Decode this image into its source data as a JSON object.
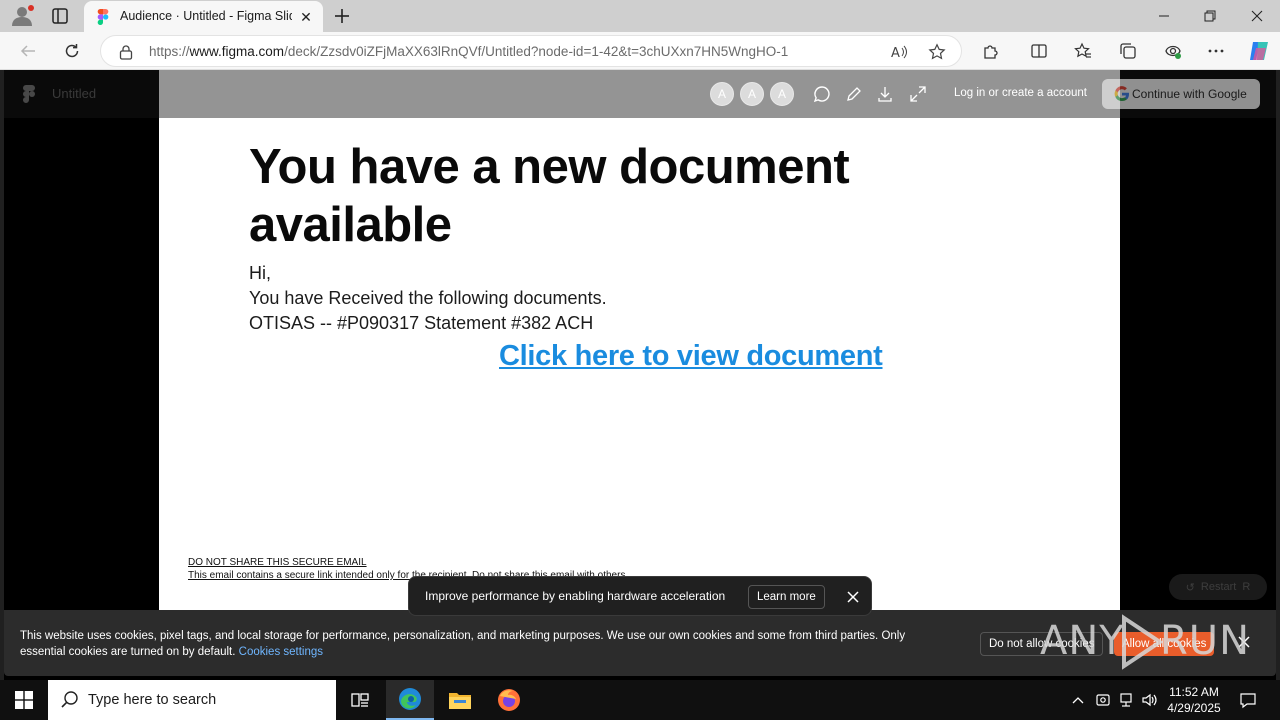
{
  "browser": {
    "tab_title": "Audience · Untitled - Figma Slides",
    "url_prefix": "https://",
    "url_host": "www.figma.com",
    "url_path": "/deck/Zzsdv0iZFjMaXX63lRnQVf/Untitled?node-id=1-42&t=3chUXxn7HN5WngHO-1"
  },
  "figma": {
    "file_name": "Untitled",
    "avatars": [
      "A",
      "A",
      "A"
    ],
    "login_label": "Log in or create a account",
    "google_button_label": "Continue with Google",
    "restart_label": "Restart"
  },
  "slide": {
    "heading_line1": "You have a new document",
    "heading_line2": "available",
    "greeting": "Hi,",
    "line1": "You have Received the following documents.",
    "line2": "OTISAS -- #P090317 Statement #382 ACH",
    "cta": "Click here to view document",
    "disclaimer_title": "DO NOT SHARE THIS SECURE EMAIL",
    "disclaimer_text": "This email contains a secure link intended only for the recipient. Do not share this email with others."
  },
  "toast": {
    "message": "Improve performance by enabling hardware acceleration",
    "learn_more": "Learn more"
  },
  "cookie": {
    "text": "This website uses cookies, pixel tags, and local storage for performance, personalization, and marketing purposes. We use our own cookies and some from third parties. Only essential cookies are turned on by default.",
    "settings_link": "Cookies settings",
    "deny_label": "Do not allow cookies",
    "allow_label": "Allow all cookies"
  },
  "watermark": {
    "left": "ANY",
    "right": "RUN"
  },
  "taskbar": {
    "search_placeholder": "Type here to search",
    "time": "11:52 AM",
    "date": "4/29/2025"
  },
  "colors": {
    "accent_link": "#1a8cdf",
    "cookie_allow": "#e95d2b",
    "taskbar_bg": "#101010"
  }
}
